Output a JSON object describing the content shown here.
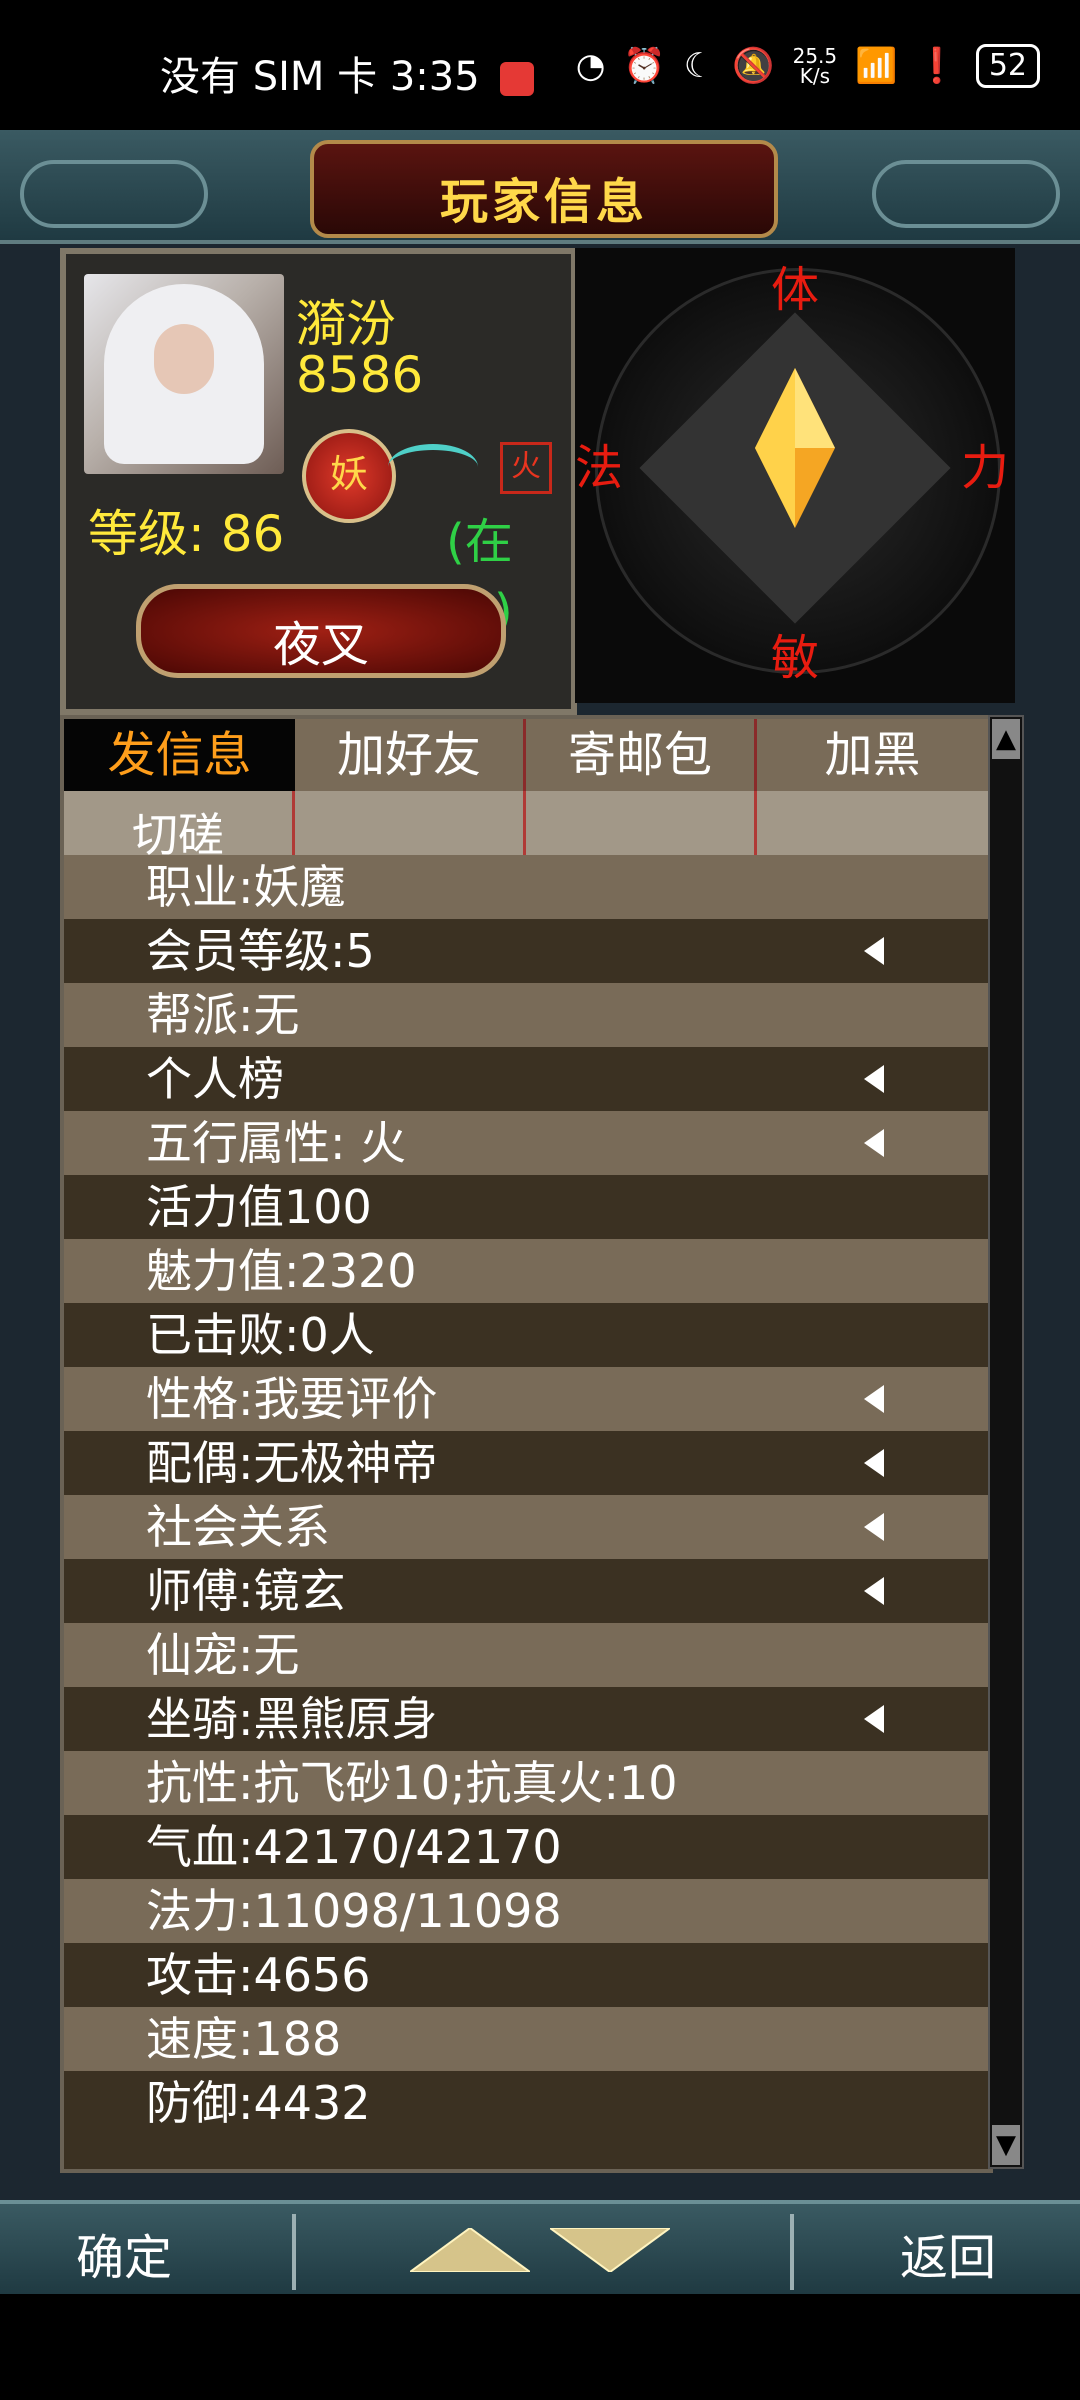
{
  "status_bar": {
    "carrier": "没有 SIM 卡",
    "time": "3:35",
    "net_speed": "25.5",
    "net_unit": "K/s",
    "battery": "52"
  },
  "header": {
    "title": "玩家信息"
  },
  "profile": {
    "name": "漪汾",
    "id": "8586",
    "faction_emblem": "妖",
    "element_badge": "火",
    "level": "等级: 86",
    "online": "(在线)",
    "nickname_button": "夜叉"
  },
  "attributes": {
    "top": "体",
    "left": "法",
    "right": "力",
    "bottom": "敏"
  },
  "tabs": [
    "发信息",
    "加好友",
    "寄邮包",
    "加黑"
  ],
  "subtab": "切磋",
  "info_rows": [
    {
      "text": "职业:妖魔",
      "arrow": false
    },
    {
      "text": "会员等级:5",
      "arrow": true
    },
    {
      "text": "帮派:无",
      "arrow": false
    },
    {
      "text": "个人榜",
      "arrow": true
    },
    {
      "text": "五行属性:  火",
      "arrow": true
    },
    {
      "text": "活力值100",
      "arrow": false
    },
    {
      "text": "魅力值:2320",
      "arrow": false
    },
    {
      "text": "已击败:0人",
      "arrow": false
    },
    {
      "text": "性格:我要评价",
      "arrow": true
    },
    {
      "text": "配偶:无极神帝",
      "arrow": true
    },
    {
      "text": "社会关系",
      "arrow": true
    },
    {
      "text": "师傅:镜玄",
      "arrow": true
    },
    {
      "text": "仙宠:无",
      "arrow": false
    },
    {
      "text": "坐骑:黑熊原身",
      "arrow": true
    },
    {
      "text": "抗性:抗飞砂10;抗真火:10",
      "arrow": false
    },
    {
      "text": "气血:42170/42170",
      "arrow": false
    },
    {
      "text": "法力:11098/11098",
      "arrow": false
    },
    {
      "text": "攻击:4656",
      "arrow": false
    },
    {
      "text": "速度:188",
      "arrow": false
    },
    {
      "text": "防御:4432",
      "arrow": false
    }
  ],
  "bottom_bar": {
    "confirm": "确定",
    "back": "返回"
  },
  "colors": {
    "title_gold": "#ffd84a",
    "name_yellow": "#ffe93b",
    "online_green": "#2fd046",
    "attr_red": "#e81c10",
    "tab_active": "#ff9e1b"
  }
}
